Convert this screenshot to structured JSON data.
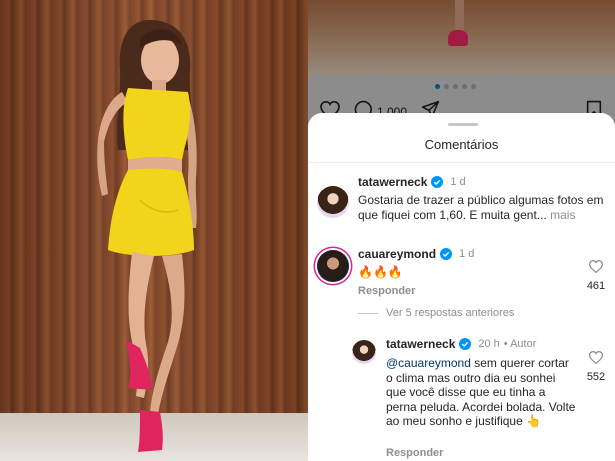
{
  "post": {
    "likes_count": "1.000"
  },
  "comments_sheet": {
    "title": "Comentários"
  },
  "comments": [
    {
      "username": "tatawerneck",
      "time": "1 d",
      "text": "Gostaria de trazer a público algumas fotos em que fiquei com 1,60. E muita gent...",
      "more_label": "mais"
    },
    {
      "username": "cauareymond",
      "time": "1 d",
      "text": "🔥🔥🔥",
      "reply_label": "Responder",
      "likes": "461",
      "view_replies_label": "Ver 5 respostas anteriores"
    },
    {
      "username": "tatawerneck",
      "time": "20 h",
      "author_label": "• Autor",
      "mention": "@cauareymond",
      "text": " sem querer cortar o clima mas outro dia eu sonhei que você disse que eu tinha a perna peluda. Acordei bolada. Volte ao meu sonho e justifique 👆",
      "reply_label": "Responder",
      "likes": "552"
    }
  ],
  "colors": {
    "verified": "#0095f6",
    "dress": "#f2d51a",
    "shoes": "#e0245e"
  },
  "icons": [
    "heart-icon",
    "comment-icon",
    "share-icon",
    "bookmark-icon",
    "verified-icon"
  ]
}
